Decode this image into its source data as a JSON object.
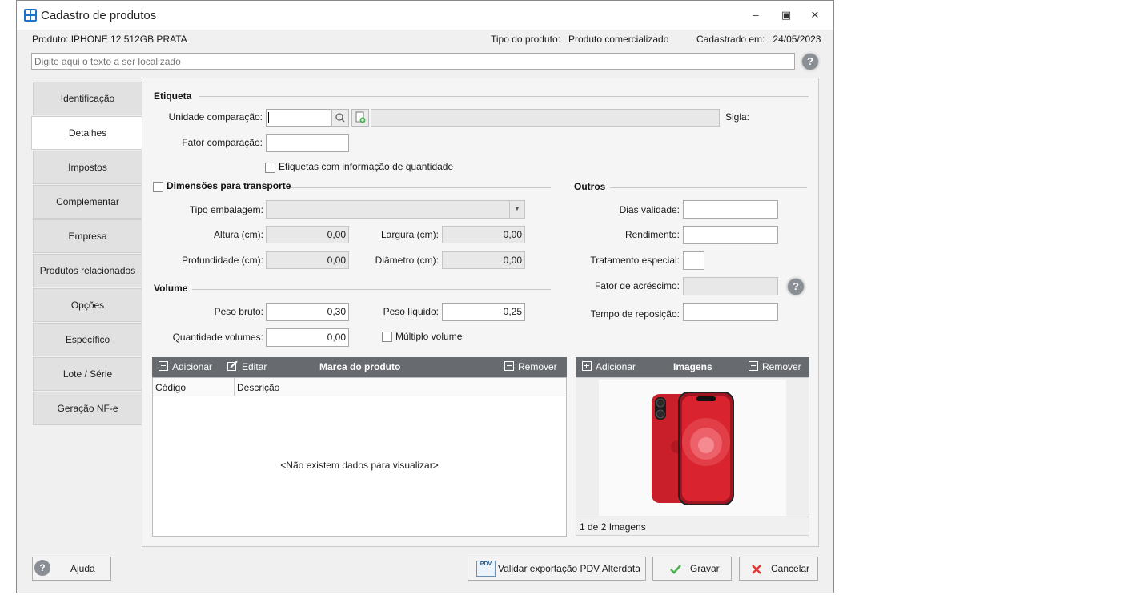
{
  "window": {
    "title": "Cadastro de produtos"
  },
  "header": {
    "produto_label": "Produto:",
    "produto_value": "IPHONE 12 512GB PRATA",
    "tipo_label": "Tipo do produto:",
    "tipo_value": "Produto comercializado",
    "cadastrado_label": "Cadastrado em:",
    "cadastrado_value": "24/05/2023"
  },
  "search": {
    "placeholder": "Digite aqui o texto a ser localizado",
    "value": ""
  },
  "tabs": [
    {
      "label": "Identificação"
    },
    {
      "label": "Detalhes"
    },
    {
      "label": "Impostos"
    },
    {
      "label": "Complementar"
    },
    {
      "label": "Empresa"
    },
    {
      "label": "Produtos relacionados"
    },
    {
      "label": "Opções"
    },
    {
      "label": "Específico"
    },
    {
      "label": "Lote / Série"
    },
    {
      "label": "Geração NF-e"
    }
  ],
  "etiqueta": {
    "title": "Etiqueta",
    "unidade_label": "Unidade comparação:",
    "unidade_value": "",
    "sigla_label": "Sigla:",
    "fator_label": "Fator comparação:",
    "fator_value": "",
    "checkbox_label": "Etiquetas com informação de quantidade"
  },
  "dimensoes": {
    "title": "Dimensões para transporte",
    "tipo_embalagem_label": "Tipo embalagem:",
    "altura_label": "Altura (cm):",
    "altura_value": "0,00",
    "largura_label": "Largura (cm):",
    "largura_value": "0,00",
    "profundidade_label": "Profundidade (cm):",
    "profundidade_value": "0,00",
    "diametro_label": "Diâmetro (cm):",
    "diametro_value": "0,00"
  },
  "outros": {
    "title": "Outros",
    "dias_validade_label": "Dias validade:",
    "rendimento_label": "Rendimento:",
    "tratamento_label": "Tratamento especial:",
    "fator_acrescimo_label": "Fator de acréscimo:",
    "tempo_reposicao_label": "Tempo de reposição:"
  },
  "volume": {
    "title": "Volume",
    "peso_bruto_label": "Peso bruto:",
    "peso_bruto_value": "0,30",
    "peso_liquido_label": "Peso líquido:",
    "peso_liquido_value": "0,25",
    "qtd_volumes_label": "Quantidade volumes:",
    "qtd_volumes_value": "0,00",
    "multiplo_label": "Múltiplo volume"
  },
  "marca_grid": {
    "add_label": "Adicionar",
    "edit_label": "Editar",
    "title": "Marca do produto",
    "remove_label": "Remover",
    "columns": [
      "Código",
      "Descrição"
    ],
    "empty_text": "<Não existem dados para visualizar>"
  },
  "imagens": {
    "add_label": "Adicionar",
    "title": "Imagens",
    "remove_label": "Remover",
    "counter": "1 de 2 Imagens"
  },
  "footer": {
    "help_label": "Ajuda",
    "validar_label": "Validar exportação PDV Alterdata",
    "pdv_badge": "PDV",
    "gravar_label": "Gravar",
    "cancelar_label": "Cancelar"
  },
  "colors": {
    "accent": "#1e73c6",
    "gridbar": "#676b70",
    "phone_red": "#d9232e"
  }
}
